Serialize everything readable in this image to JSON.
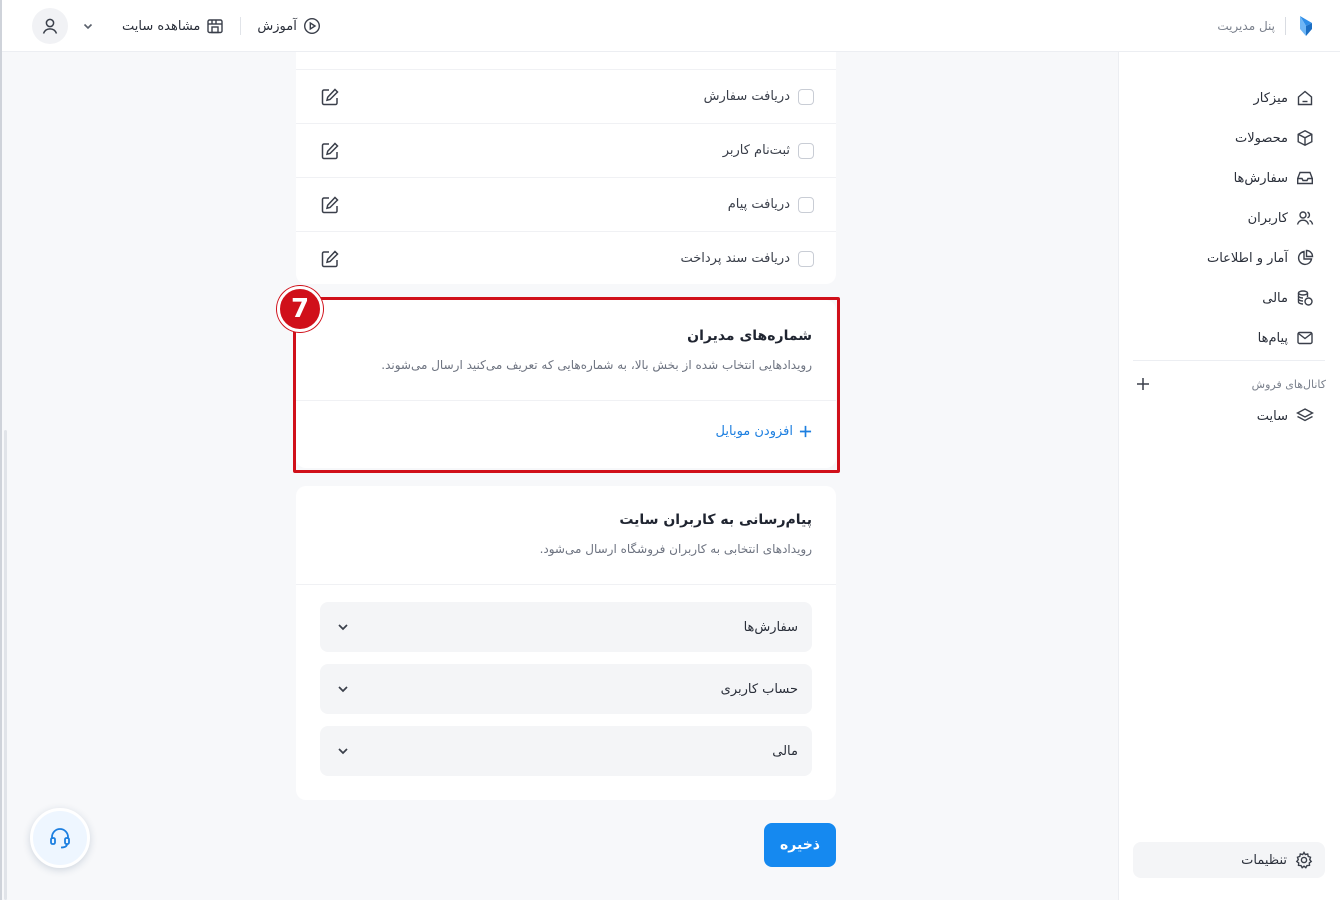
{
  "brand": {
    "text": "پنل مدیریت",
    "color": "#2f8ee8"
  },
  "topbar": {
    "tutorial_label": "آموزش",
    "view_site_label": "مشاهده سایت"
  },
  "sidebar": {
    "items": [
      {
        "label": "میزکار",
        "icon": "home-icon"
      },
      {
        "label": "محصولات",
        "icon": "box-icon"
      },
      {
        "label": "سفارش‌ها",
        "icon": "inbox-icon"
      },
      {
        "label": "کاربران",
        "icon": "users-icon"
      },
      {
        "label": "آمار و اطلاعات",
        "icon": "pie-chart-icon"
      },
      {
        "label": "مالی",
        "icon": "coins-icon"
      },
      {
        "label": "پیام‌ها",
        "icon": "mail-icon"
      }
    ],
    "channels_label": "کانال‌های فروش",
    "site_label": "سایت",
    "settings_label": "تنظیمات"
  },
  "events": {
    "rows": [
      {
        "label": "دریافت سفارش",
        "checked": false
      },
      {
        "label": "ثبت‌نام کاربر",
        "checked": false
      },
      {
        "label": "دریافت پیام",
        "checked": false
      },
      {
        "label": "دریافت سند پرداخت",
        "checked": false
      }
    ]
  },
  "admins": {
    "step": "7",
    "title": "شماره‌های مدیران",
    "description": "رویدادهایی انتخاب شده از بخش بالا، به شماره‌هایی که تعریف می‌کنید ارسال می‌شوند.",
    "add_label": "افزودن موبایل",
    "highlight_color": "#d0101a"
  },
  "notify": {
    "title": "پیام‌رسانی به کاربران سایت",
    "description": "رویدادهای انتخابی به کاربران فروشگاه ارسال می‌شود.",
    "sections": [
      "سفارش‌ها",
      "حساب کاربری",
      "مالی"
    ]
  },
  "save_label": "ذخیره",
  "accent_color": "#1589f0"
}
